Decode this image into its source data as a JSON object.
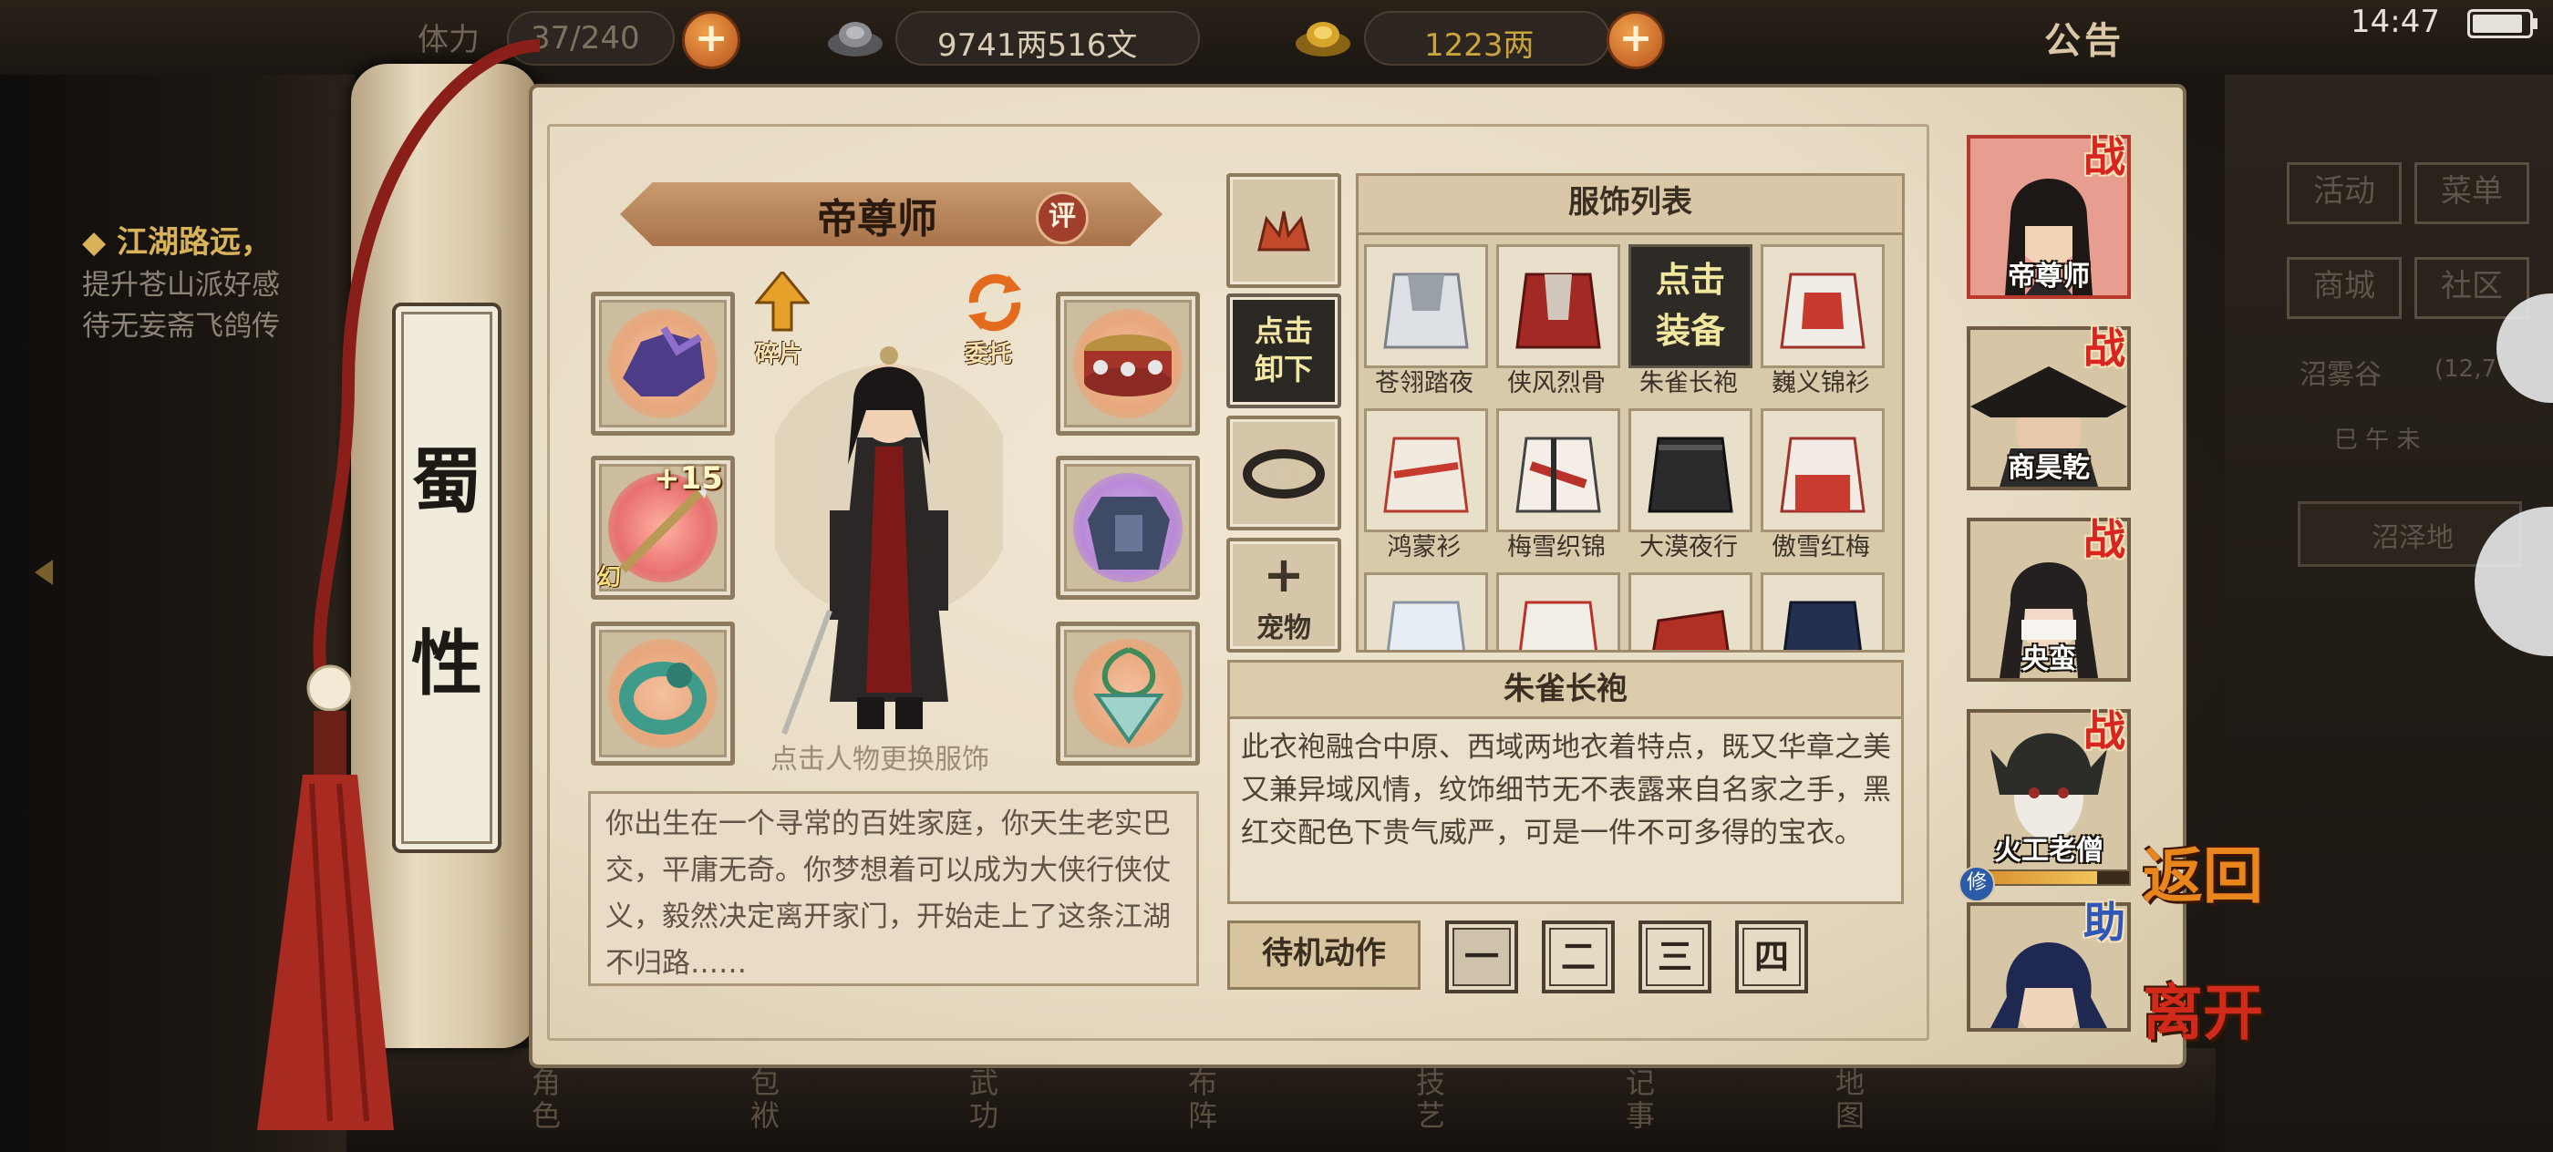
{
  "topbar": {
    "stamina_label": "体力",
    "stamina": "37/240",
    "silver": "9741两516文",
    "gold": "1223两",
    "notice": "公告",
    "clock": "14:47",
    "battery_level": 0.9
  },
  "quest": {
    "title": "江湖路远，",
    "lines": [
      "提升苍山派好感",
      "待无妄斋飞鸽传"
    ]
  },
  "scroll": {
    "attr_top": "蜀",
    "attr_bottom": "性"
  },
  "character": {
    "name": "帝尊师",
    "rate_label": "评",
    "fragment_label": "碎片",
    "entrust_label": "委托",
    "caption": "点击人物更换服饰",
    "weapon_plus": "+15",
    "weapon_tag": "幻"
  },
  "bio": {
    "text": "你出生在一个寻常的百姓家庭，你天生老实巴交，平庸无奇。你梦想着可以成为大侠行侠仗义，毅然决定离开家门，开始走上了这条江湖不归路……"
  },
  "middle": {
    "unequip_line1": "点击",
    "unequip_line2": "卸下",
    "pet_label": "宠物"
  },
  "costume_list": {
    "header": "服饰列表",
    "equip_line1": "点击",
    "equip_line2": "装备",
    "items": [
      {
        "label": "苍翎踏夜"
      },
      {
        "label": "侠风烈骨"
      },
      {
        "label": "朱雀长袍",
        "active": true
      },
      {
        "label": "巍义锦衫"
      },
      {
        "label": "鸿蒙衫"
      },
      {
        "label": "梅雪织锦"
      },
      {
        "label": "大漠夜行"
      },
      {
        "label": "傲雪红梅"
      },
      {
        "label": ""
      },
      {
        "label": ""
      },
      {
        "label": ""
      },
      {
        "label": ""
      }
    ]
  },
  "description": {
    "title": "朱雀长袍",
    "text": "此衣袍融合中原、西域两地衣着特点，既又华章之美又兼异域风情，纹饰细节无不表露来自名家之手，黑红交配色下贵气威严，可是一件不可多得的宝衣。"
  },
  "idle": {
    "label": "待机动作",
    "options": [
      "一",
      "二",
      "三",
      "四"
    ]
  },
  "party": [
    {
      "name": "帝尊师",
      "tag": "战"
    },
    {
      "name": "商昊乾",
      "tag": "战"
    },
    {
      "name": "央蛮",
      "tag": "战"
    },
    {
      "name": "火工老僧",
      "tag": "战"
    },
    {
      "name": "",
      "tag": "助"
    }
  ],
  "party_badge": "修",
  "actions": {
    "return": "返回",
    "leave": "离开"
  },
  "side_menu": {
    "items": [
      "活动",
      "菜单",
      "商城",
      "社区"
    ],
    "location": "沼雾谷",
    "coords": "(12,7",
    "time_row": "巳 午 未",
    "area": "沼泽地"
  },
  "bottom_nav": [
    "角色",
    "包袱",
    "武功",
    "布阵",
    "技艺",
    "记事",
    "地图"
  ],
  "colors": {
    "accent_red": "#d8251f",
    "gold": "#c9a33d",
    "parchment": "#e7dbc3"
  }
}
